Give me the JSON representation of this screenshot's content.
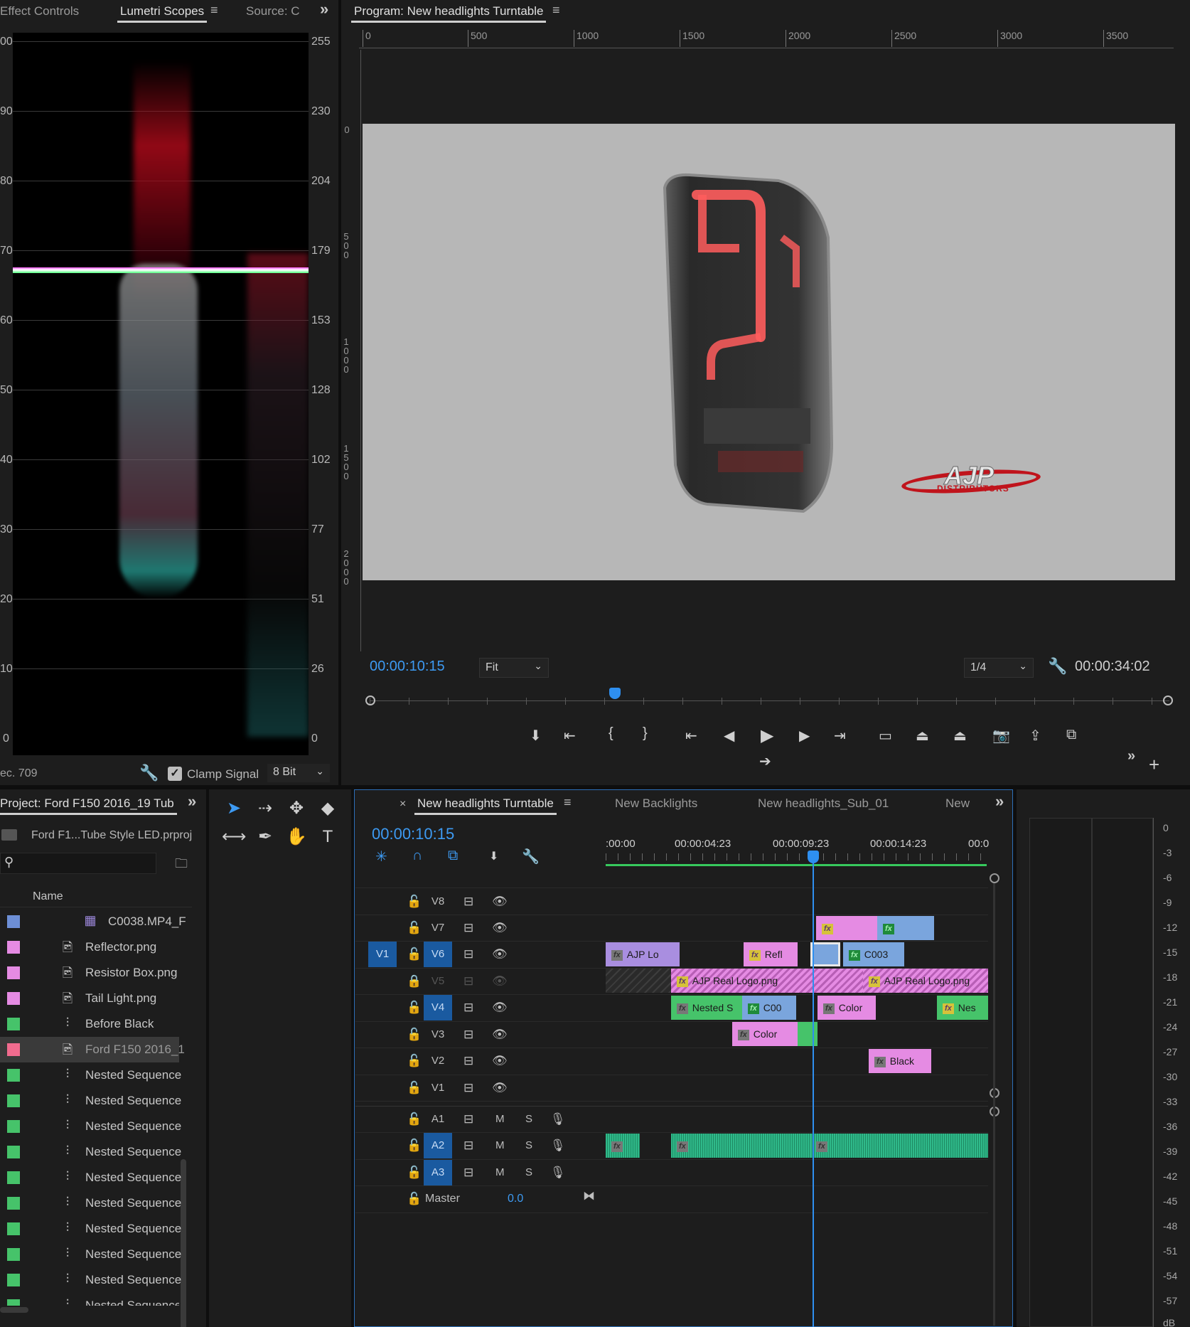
{
  "left_panel": {
    "tabs": [
      "Effect Controls",
      "Lumetri Scopes",
      "Source: C"
    ],
    "right_scale": [
      "255",
      "230",
      "204",
      "179",
      "153",
      "128",
      "102",
      "77",
      "51",
      "26",
      "0"
    ],
    "left_scale": [
      "00",
      "90",
      "80",
      "70",
      "60",
      "50",
      "40",
      "30",
      "20",
      "10",
      "0"
    ],
    "footer_colorspace": "ec. 709",
    "clamp_label": "Clamp Signal",
    "bit_depth": "8 Bit"
  },
  "program_monitor": {
    "title": "Program: New headlights Turntable",
    "ruler": [
      "0",
      "500",
      "1000",
      "1500",
      "2000",
      "2500",
      "3000",
      "3500"
    ],
    "vertical_ruler": [
      "0",
      "500",
      "1000",
      "1500",
      "2000"
    ],
    "timecode_current": "00:00:10:15",
    "fit": "Fit",
    "resolution": "1/4",
    "timecode_duration": "00:00:34:02",
    "logo_text": "AJP",
    "logo_sub": "DISTRIBUTORS"
  },
  "project_panel": {
    "title": "Project: Ford F150 2016_19 Tub",
    "file": "Ford F1...Tube Style LED.prproj",
    "column_name": "Name",
    "items": [
      {
        "name": "C0038.MP4_F",
        "color": "#6d8fd6",
        "icon": "film-icon"
      },
      {
        "name": "Reflector.png",
        "color": "#e58be3",
        "icon": "image-icon"
      },
      {
        "name": "Resistor Box.png",
        "color": "#e58be3",
        "icon": "image-icon"
      },
      {
        "name": "Tail Light.png",
        "color": "#e58be3",
        "icon": "image-icon"
      },
      {
        "name": "Before Black",
        "color": "#46c36a",
        "icon": "sequence-icon"
      },
      {
        "name": "Ford F150 2016_1",
        "color": "#f06b8e",
        "icon": "image-icon"
      },
      {
        "name": "Nested Sequence",
        "color": "#46c36a",
        "icon": "sequence-icon"
      },
      {
        "name": "Nested Sequence",
        "color": "#46c36a",
        "icon": "sequence-icon"
      },
      {
        "name": "Nested Sequence",
        "color": "#46c36a",
        "icon": "sequence-icon"
      },
      {
        "name": "Nested Sequence",
        "color": "#46c36a",
        "icon": "sequence-icon"
      },
      {
        "name": "Nested Sequence",
        "color": "#46c36a",
        "icon": "sequence-icon"
      },
      {
        "name": "Nested Sequence",
        "color": "#46c36a",
        "icon": "sequence-icon"
      },
      {
        "name": "Nested Sequence",
        "color": "#46c36a",
        "icon": "sequence-icon"
      },
      {
        "name": "Nested Sequence",
        "color": "#46c36a",
        "icon": "sequence-icon"
      },
      {
        "name": "Nested Sequence",
        "color": "#46c36a",
        "icon": "sequence-icon"
      },
      {
        "name": "Nested Sequence",
        "color": "#46c36a",
        "icon": "sequence-icon"
      }
    ]
  },
  "timeline": {
    "tabs": [
      "New headlights Turntable",
      "New Backlights",
      "New headlights_Sub_01",
      "New"
    ],
    "timecode": "00:00:10:15",
    "ruler": [
      ":00:00",
      "00:00:04:23",
      "00:00:09:23",
      "00:00:14:23",
      "00:0"
    ],
    "video_tracks": [
      "V8",
      "V7",
      "V6",
      "V5",
      "V4",
      "V3",
      "V2",
      "V1"
    ],
    "source_patch": "V1",
    "audio_tracks": [
      "A1",
      "A2",
      "A3"
    ],
    "audio_m": "M",
    "audio_s": "S",
    "master_label": "Master",
    "master_value": "0.0",
    "clips": {
      "ajp_lo": "AJP Lo",
      "refl": "Refl",
      "c003": "C003",
      "ajp_real_1": "AJP Real Logo.png",
      "ajp_real_2": "AJP Real Logo.png",
      "nested_s": "Nested S",
      "c00": "C00",
      "color_1": "Color",
      "nes": "Nes",
      "color_2": "Color",
      "black": "Black",
      "fx": "fx"
    }
  },
  "audio_meter": {
    "scale": [
      "0",
      "-3",
      "-6",
      "-9",
      "-12",
      "-15",
      "-18",
      "-21",
      "-24",
      "-27",
      "-30",
      "-33",
      "-36",
      "-39",
      "-42",
      "-45",
      "-48",
      "-51",
      "-54",
      "-57",
      "dB"
    ]
  }
}
